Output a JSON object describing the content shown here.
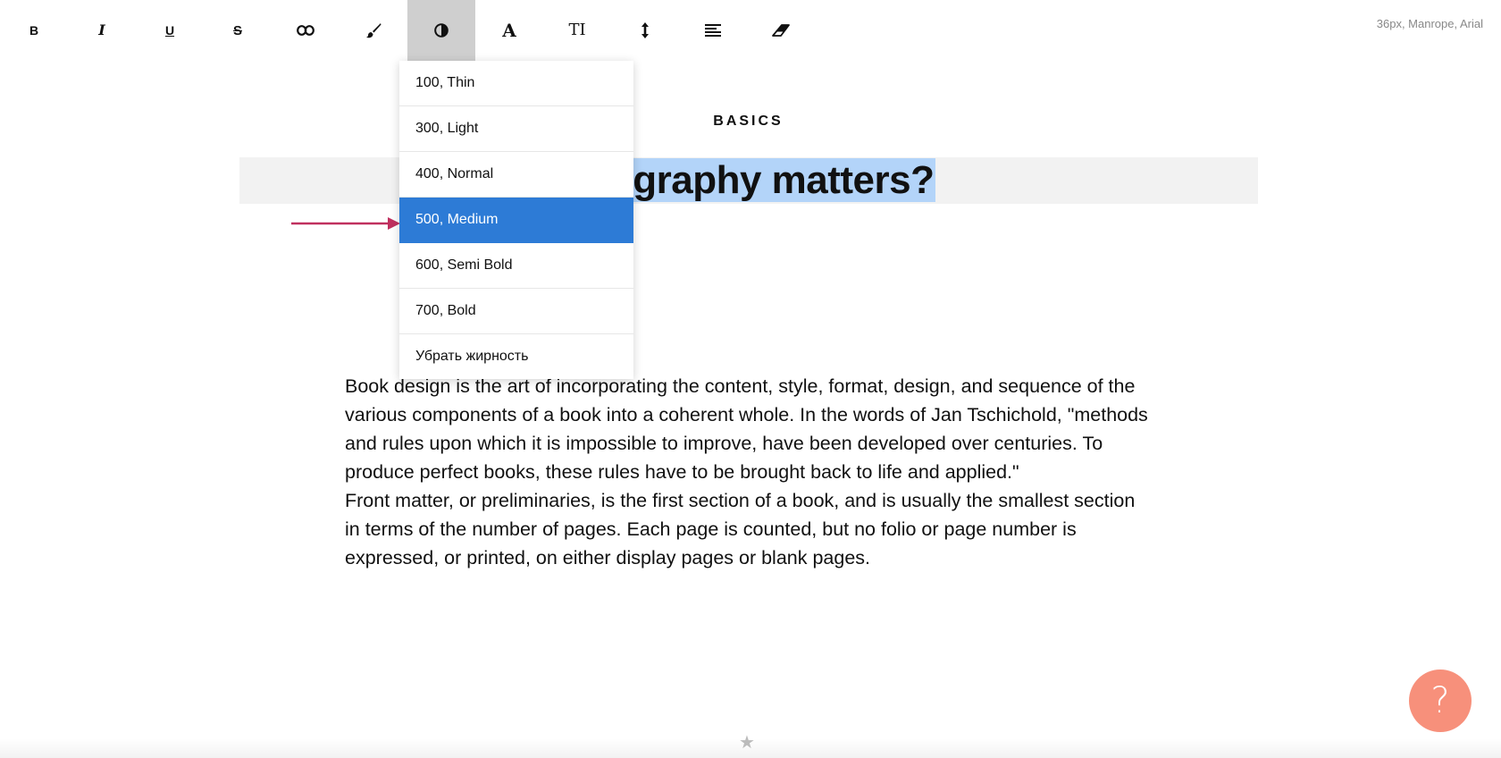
{
  "toolbar": {
    "items": [
      {
        "name": "bold-icon",
        "glyph": "B"
      },
      {
        "name": "italic-icon",
        "glyph": "I"
      },
      {
        "name": "underline-icon",
        "glyph": "U"
      },
      {
        "name": "strikethrough-icon",
        "glyph": "S"
      },
      {
        "name": "link-icon"
      },
      {
        "name": "brush-icon"
      },
      {
        "name": "contrast-icon",
        "active": true
      },
      {
        "name": "font-icon",
        "glyph": "A"
      },
      {
        "name": "text-size-icon",
        "glyph": "TI"
      },
      {
        "name": "line-height-icon"
      },
      {
        "name": "align-icon"
      },
      {
        "name": "eraser-icon"
      }
    ],
    "font_info": "36px, Manrope, Arial"
  },
  "weight_menu": {
    "items": [
      {
        "label": "100, Thin"
      },
      {
        "label": "300, Light"
      },
      {
        "label": "400, Normal"
      },
      {
        "label": "500, Medium",
        "selected": true
      },
      {
        "label": "600, Semi Bold"
      },
      {
        "label": "700, Bold"
      },
      {
        "label": "Убрать жирность"
      }
    ]
  },
  "article": {
    "section_label": "BASICS",
    "title_visible": "ypography matters?",
    "paragraphs": [
      "Book design is the art of incorporating the content, style, format, design, and sequence of the various components of a book into a coherent whole. In the words of Jan Tschichold, \"methods and rules upon which it is impossible to improve, have been developed over centuries. To produce perfect books, these rules have to be brought back to life and applied.\"",
      "Front matter, or preliminaries, is the first section of a book, and is usually the smallest section in terms of the number of pages. Each page is counted, but no folio or page number is expressed, or printed, on either display pages or blank pages."
    ]
  },
  "help": {
    "label": "?"
  },
  "footer": {
    "star": "★"
  },
  "colors": {
    "accent_selected": "#2d7bd6",
    "selection_highlight": "#b3d4f9",
    "arrow": "#c0305f",
    "help_button": "#f7907b"
  }
}
